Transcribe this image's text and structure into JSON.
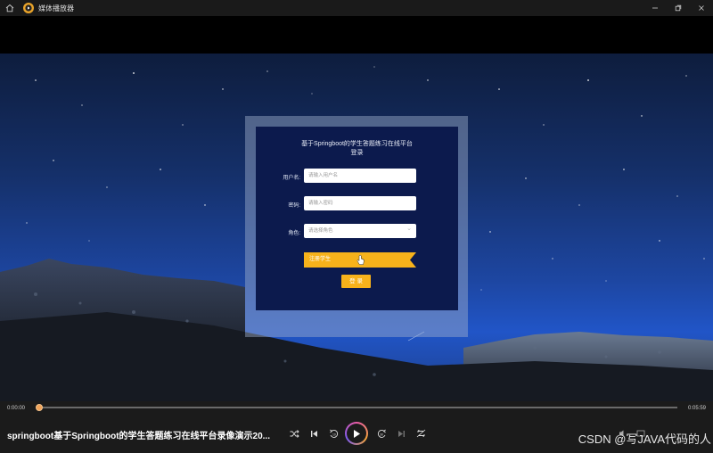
{
  "window": {
    "title": "媒体播放器"
  },
  "login": {
    "title_line1": "基于Springboot的学生答题练习在线平台",
    "title_line2": "登录",
    "username_label": "用户名:",
    "username_placeholder": "请输入用户名",
    "password_label": "密码:",
    "password_placeholder": "请输入密码",
    "role_label": "角色:",
    "role_placeholder": "请选择角色",
    "role_tag": "注册学生",
    "login_button": "登 录",
    "accent": "#f7b21b"
  },
  "player": {
    "current_time": "0:00:00",
    "total_time": "0:05:59",
    "progress": 0.0,
    "video_title": "springboot基于Springboot的学生答题练习在线平台录像演示20...",
    "accent": "#f0a35a"
  },
  "watermark": "CSDN @写JAVA代码的人",
  "icons": {
    "home": "home-icon",
    "app": "media-player-icon",
    "minimize": "minimize-icon",
    "restore": "restore-icon",
    "close": "close-icon",
    "shuffle": "shuffle-icon",
    "previous": "previous-icon",
    "rewind": "rewind-10-icon",
    "play": "play-icon",
    "forward": "forward-30-icon",
    "next": "next-icon",
    "repeat": "repeat-off-icon"
  }
}
